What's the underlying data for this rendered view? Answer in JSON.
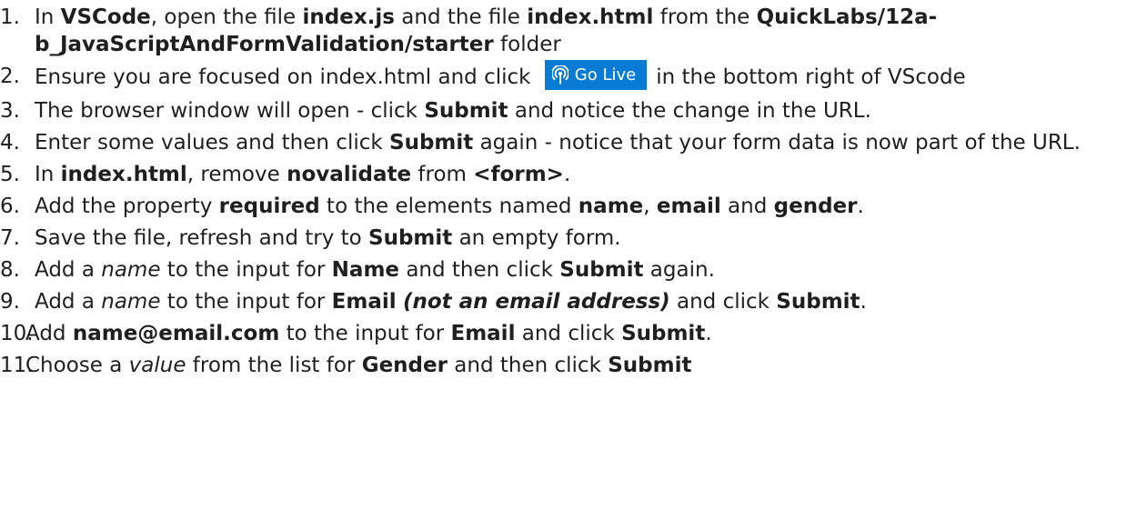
{
  "steps": [
    {
      "num": "1.",
      "parts": [
        {
          "t": "In ",
          "s": "n"
        },
        {
          "t": "VSCode",
          "s": "b"
        },
        {
          "t": ", open the file ",
          "s": "n"
        },
        {
          "t": "index.js",
          "s": "b"
        },
        {
          "t": " and the file ",
          "s": "n"
        },
        {
          "t": "index.html",
          "s": "b"
        },
        {
          "t": " from the ",
          "s": "n"
        },
        {
          "t": "QuickLabs/12a-b_JavaScriptAndFormValidation/starter",
          "s": "b"
        },
        {
          "t": " folder",
          "s": "n"
        }
      ]
    },
    {
      "num": "2.",
      "parts": [
        {
          "t": "Ensure you are focused on index.html and click ",
          "s": "n"
        },
        {
          "t": "Go Live",
          "s": "golive"
        },
        {
          "t": "in the bottom right of VScode",
          "s": "n"
        }
      ]
    },
    {
      "num": "3.",
      "parts": [
        {
          "t": "The browser window will open - click ",
          "s": "n"
        },
        {
          "t": "Submit",
          "s": "b"
        },
        {
          "t": " and notice the change in the URL.",
          "s": "n"
        }
      ]
    },
    {
      "num": "4.",
      "parts": [
        {
          "t": "Enter some values and then click ",
          "s": "n"
        },
        {
          "t": "Submit",
          "s": "b"
        },
        {
          "t": " again - notice that your form data is now part of the URL.",
          "s": "n"
        }
      ]
    },
    {
      "num": "5.",
      "parts": [
        {
          "t": "In ",
          "s": "n"
        },
        {
          "t": "index.html",
          "s": "b"
        },
        {
          "t": ", remove ",
          "s": "n"
        },
        {
          "t": "novalidate",
          "s": "b"
        },
        {
          "t": " from ",
          "s": "n"
        },
        {
          "t": "<form>",
          "s": "b"
        },
        {
          "t": ".",
          "s": "n"
        }
      ]
    },
    {
      "num": "6.",
      "parts": [
        {
          "t": "Add the property ",
          "s": "n"
        },
        {
          "t": "required",
          "s": "b"
        },
        {
          "t": " to the elements named ",
          "s": "n"
        },
        {
          "t": "name",
          "s": "b"
        },
        {
          "t": ", ",
          "s": "n"
        },
        {
          "t": "email",
          "s": "b"
        },
        {
          "t": " and ",
          "s": "n"
        },
        {
          "t": "gender",
          "s": "b"
        },
        {
          "t": ".",
          "s": "n"
        }
      ]
    },
    {
      "num": "7.",
      "parts": [
        {
          "t": "Save the file, refresh and try to ",
          "s": "n"
        },
        {
          "t": "Submit",
          "s": "b"
        },
        {
          "t": " an empty form.",
          "s": "n"
        }
      ]
    },
    {
      "num": "8.",
      "parts": [
        {
          "t": "Add a ",
          "s": "n"
        },
        {
          "t": "name",
          "s": "i"
        },
        {
          "t": " to the input for ",
          "s": "n"
        },
        {
          "t": "Name",
          "s": "b"
        },
        {
          "t": " and then click ",
          "s": "n"
        },
        {
          "t": "Submit",
          "s": "b"
        },
        {
          "t": " again.",
          "s": "n"
        }
      ]
    },
    {
      "num": "9.",
      "parts": [
        {
          "t": "Add a ",
          "s": "n"
        },
        {
          "t": "name",
          "s": "i"
        },
        {
          "t": " to the input for ",
          "s": "n"
        },
        {
          "t": "Email",
          "s": "b"
        },
        {
          "t": " ",
          "s": "n"
        },
        {
          "t": "(not an email address)",
          "s": "bi"
        },
        {
          "t": " and click ",
          "s": "n"
        },
        {
          "t": "Submit",
          "s": "b"
        },
        {
          "t": ".",
          "s": "n"
        }
      ]
    },
    {
      "num": "10.",
      "parts": [
        {
          "t": "Add ",
          "s": "n"
        },
        {
          "t": "name@email.com",
          "s": "b"
        },
        {
          "t": " to the input for ",
          "s": "n"
        },
        {
          "t": "Email",
          "s": "b"
        },
        {
          "t": " and click ",
          "s": "n"
        },
        {
          "t": "Submit",
          "s": "b"
        },
        {
          "t": ".",
          "s": "n"
        }
      ]
    },
    {
      "num": "11.",
      "parts": [
        {
          "t": "Choose a ",
          "s": "n"
        },
        {
          "t": "value",
          "s": "i"
        },
        {
          "t": " from the list for ",
          "s": "n"
        },
        {
          "t": "Gender",
          "s": "b"
        },
        {
          "t": " and then click ",
          "s": "n"
        },
        {
          "t": "Submit",
          "s": "b"
        }
      ]
    }
  ],
  "golive_icon": "broadcast-icon",
  "golive_color": "#0a7bd4"
}
